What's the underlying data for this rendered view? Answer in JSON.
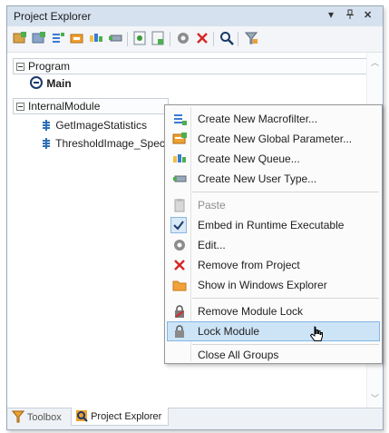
{
  "titlebar": {
    "title": "Project Explorer",
    "dropdown_glyph": "▾",
    "pin_glyph": "ⵜ",
    "close_glyph": "✕"
  },
  "toolbar": {
    "icons": [
      "new-macrofilter-icon",
      "new-global-parameter-icon",
      "new-queue-icon",
      "new-user-type-icon",
      "new-module-icon",
      "import-module-icon",
      "properties-icon",
      "remove-icon",
      "find-icon",
      "filter-icon"
    ]
  },
  "tree": {
    "program": {
      "label": "Program",
      "children": [
        {
          "label": "Main"
        }
      ]
    },
    "module": {
      "label": "InternalModule",
      "children": [
        {
          "label": "GetImageStatistics"
        },
        {
          "label": "ThresholdImage_Special"
        }
      ]
    }
  },
  "context_menu": {
    "items": [
      {
        "label": "Create New Macrofilter...",
        "icon": "macrofilter-icon",
        "disabled": false
      },
      {
        "label": "Create New Global Parameter...",
        "icon": "global-parameter-icon",
        "disabled": false
      },
      {
        "label": "Create New Queue...",
        "icon": "queue-icon",
        "disabled": false
      },
      {
        "label": "Create New User Type...",
        "icon": "user-type-icon",
        "disabled": false
      },
      {
        "label": "Paste",
        "icon": "paste-icon",
        "disabled": true
      },
      {
        "label": "Embed in Runtime Executable",
        "icon": "checkmark-icon",
        "disabled": false,
        "checked": true
      },
      {
        "label": "Edit...",
        "icon": "gear-icon",
        "disabled": false
      },
      {
        "label": "Remove from Project",
        "icon": "remove-icon",
        "disabled": false
      },
      {
        "label": "Show in Windows Explorer",
        "icon": "folder-icon",
        "disabled": false
      },
      {
        "label": "Remove Module Lock",
        "icon": "lock-remove-icon",
        "disabled": false
      },
      {
        "label": "Lock Module",
        "icon": "lock-icon",
        "disabled": false,
        "highlighted": true
      },
      {
        "label": "Close All Groups",
        "icon": "",
        "disabled": false
      }
    ]
  },
  "bottom_tabs": [
    {
      "label": "Toolbox",
      "active": false
    },
    {
      "label": "Project Explorer",
      "active": true
    }
  ],
  "colors": {
    "titlebar": "#d6e1ef",
    "highlight": "#cde4f7",
    "highlight_border": "#84b6e4"
  }
}
